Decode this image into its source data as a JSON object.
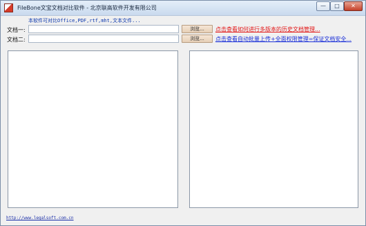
{
  "window": {
    "title": "FileBone文宝文档对比软件 - 北京联高软件开发有限公司",
    "minimize_glyph": "—",
    "maximize_glyph": "□",
    "close_glyph": "✕"
  },
  "header": {
    "hint": "本软件可对比Office,PDF,rtf,mht,文本文件..."
  },
  "doc1": {
    "label": "文档一:",
    "value": "",
    "browse_label": "浏览..."
  },
  "doc2": {
    "label": "文档二:",
    "value": "",
    "browse_label": "浏览..."
  },
  "links": {
    "history": "点击查看如何进行多版本的历史文档管理...",
    "upload": "点击查看自动批量上传+全面权限管理=保证文档安全..."
  },
  "footer": {
    "url": "http://www.legalsoft.com.cn"
  },
  "colors": {
    "history_link": "#e21818",
    "upload_link": "#1a2fd8",
    "hint_text": "#0b37ad"
  }
}
